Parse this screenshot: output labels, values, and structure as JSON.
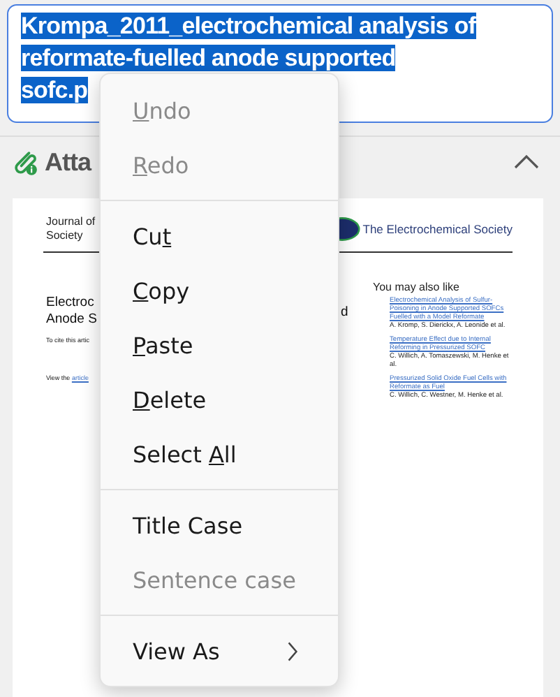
{
  "filename_field": {
    "lines": [
      "Krompa_2011_electrochemical analysis of",
      "reformate-fuelled anode supported",
      "sofc.p"
    ],
    "selected": true
  },
  "attachments": {
    "title": "Atta",
    "expanded": true
  },
  "document": {
    "journal": [
      "Journal of",
      "Society"
    ],
    "publisher": "The Electrochemical Society",
    "title_fragments": [
      "Electroc",
      "Anode S"
    ],
    "title_tail": "d",
    "cite": "To cite this artic",
    "view_prefix": "View the ",
    "view_link": "article",
    "related_heading": "You may also like",
    "related": [
      {
        "title": "Electrochemical Analysis of Sulfur-Poisoning in Anode Supported SOFCs Fuelled with a Model Reformate",
        "authors": "A. Kromp, S. Dierickx, A. Leonide et al."
      },
      {
        "title": "Temperature Effect due to Internal Reforming in Pressurized SOFC",
        "authors": "C. Willich, A. Tomaszewski, M. Henke et al."
      },
      {
        "title": "Pressurized Solid Oxide Fuel Cells with Reformate as Fuel",
        "authors": "C. Willich, C. Westner, M. Henke et al."
      }
    ]
  },
  "context_menu": [
    {
      "kind": "item",
      "key": "U",
      "rest": "ndo",
      "disabled": true
    },
    {
      "kind": "item",
      "key": "R",
      "rest": "edo",
      "disabled": true
    },
    {
      "kind": "separator"
    },
    {
      "kind": "item",
      "lead": "Cu",
      "key": "t",
      "disabled": false
    },
    {
      "kind": "item",
      "key": "C",
      "rest": "opy",
      "disabled": false
    },
    {
      "kind": "item",
      "key": "P",
      "rest": "aste",
      "disabled": false
    },
    {
      "kind": "item",
      "key": "D",
      "rest": "elete",
      "disabled": false
    },
    {
      "kind": "item",
      "lead": "Select ",
      "key": "A",
      "rest": "ll",
      "disabled": false
    },
    {
      "kind": "separator"
    },
    {
      "kind": "item",
      "rest": "Title Case",
      "disabled": false
    },
    {
      "kind": "item",
      "rest": "Sentence case",
      "disabled": true
    },
    {
      "kind": "separator"
    },
    {
      "kind": "submenu",
      "rest": "View As",
      "disabled": false
    }
  ]
}
